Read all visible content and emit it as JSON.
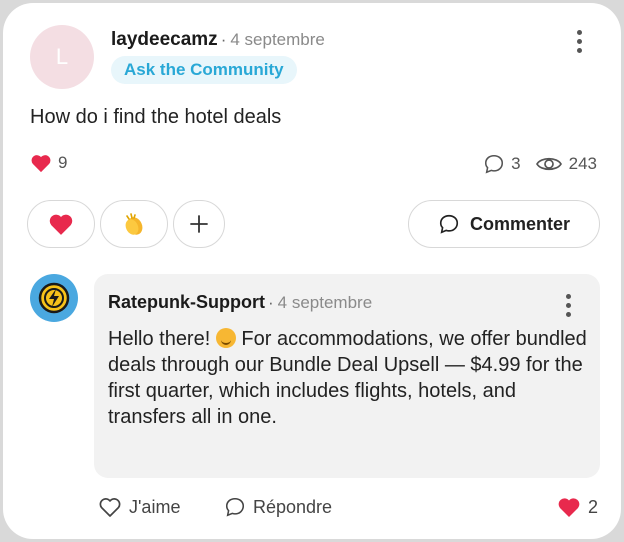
{
  "post": {
    "avatar_initial": "L",
    "author": "laydeecamz",
    "separator": "·",
    "date": "4 septembre",
    "tag": "Ask the Community",
    "text": "How do i find the hotel deals",
    "likes_count": "9",
    "comments_count": "3",
    "views_count": "243"
  },
  "actions": {
    "comment_label": "Commenter"
  },
  "reply": {
    "author": "Ratepunk-Support",
    "separator": "·",
    "date": "4 septembre",
    "text_before_emoji": "Hello there!",
    "text_after_emoji": "For accommodations, we offer bundled deals through our Bundle Deal Upsell — $4.99 for the first quarter, which includes flights, hotels, and transfers all in one.",
    "like_label": "J'aime",
    "reply_label": "Répondre",
    "likes_count": "2"
  },
  "colors": {
    "heart": "#e8294d",
    "tag_text": "#29a8d6",
    "tag_bg": "#e8f6fb",
    "avatar_support_bg": "#4aa8e0"
  }
}
